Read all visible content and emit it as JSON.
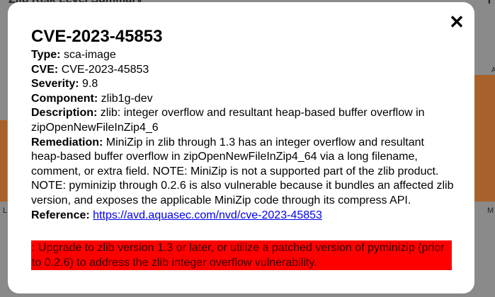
{
  "background": {
    "title": "Zlib Risk Level Summary",
    "right_glyph": "T",
    "tick_left": "L",
    "tick_right": "M",
    "right_mark": "A"
  },
  "modal": {
    "title": "CVE-2023-45853",
    "close_label": "✕",
    "fields": {
      "type_label": "Type:",
      "type_value": "sca-image",
      "cve_label": "CVE:",
      "cve_value": "CVE-2023-45853",
      "severity_label": "Severity:",
      "severity_value": "9.8",
      "component_label": "Component:",
      "component_value": "zlib1g-dev",
      "description_label": "Description:",
      "description_value": "zlib: integer overflow and resultant heap-based buffer overflow in zipOpenNewFileInZip4_6",
      "remediation_label": "Remediation:",
      "remediation_value": "MiniZip in zlib through 1.3 has an integer overflow and resultant heap-based buffer overflow in zipOpenNewFileInZip4_64 via a long filename, comment, or extra field. NOTE: MiniZip is not a supported part of the zlib product. NOTE: pyminizip through 0.2.6 is also vulnerable because it bundles an affected zlib version, and exposes the applicable MiniZip code through its compress API.",
      "reference_label": "Reference:",
      "reference_url": "https://avd.aquasec.com/nvd/cve-2023-45853"
    },
    "advice": ": Upgrade to zlib version 1.3 or later, or utilize a patched version of pyminizip (prior to 0.2.6) to address the zlib integer overflow vulnerability."
  },
  "colors": {
    "backdrop": "#8a8a8a",
    "chart_bar": "#a8612a",
    "advice_bg": "#ff0000",
    "link": "#0000ee"
  }
}
